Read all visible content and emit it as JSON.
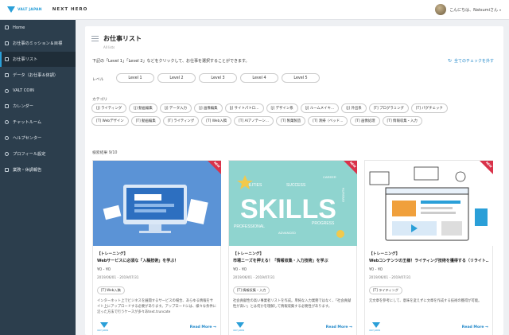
{
  "header": {
    "logo_text": "VALT JAPAN",
    "brand": "NEXT HERO",
    "greeting": "こんにちは、Natsumiさん",
    "caret": "▾"
  },
  "sidebar": {
    "items": [
      {
        "label": "Home",
        "icon": "home-icon"
      },
      {
        "label": "お仕事のミッション＆目標",
        "icon": "flag-icon"
      },
      {
        "label": "お仕事リスト",
        "icon": "list-icon"
      },
      {
        "label": "データ（お仕事＆体調）",
        "icon": "chart-icon"
      },
      {
        "label": "VALT COIN",
        "icon": "coin-icon"
      },
      {
        "label": "カレンダー",
        "icon": "calendar-icon"
      },
      {
        "label": "チャットルーム",
        "icon": "chat-icon"
      },
      {
        "label": "ヘルプセンター",
        "icon": "help-icon"
      },
      {
        "label": "プロフィール設定",
        "icon": "profile-icon"
      },
      {
        "label": "業務・休調報告",
        "icon": "report-icon"
      }
    ],
    "active_index": 2
  },
  "page": {
    "title": "お仕事リスト",
    "subtitle": "All lists",
    "instruction": "下記の「Level 1」「Level 2」などをクリックして、お仕事を選択することができます。",
    "clear_link": "全てのチェックを外す",
    "clear_icon": "↻",
    "level_label": "レベル",
    "levels": [
      "Level 1",
      "Level 2",
      "Level 3",
      "Level 4",
      "Level 5"
    ],
    "category_label": "カテゴリ",
    "categories": [
      "[J] ライティング",
      "[J] 動画編集",
      "[J] データ入力",
      "[J] 画像編集",
      "[J] サイトパトロ…",
      "[J] デザイン系",
      "[J] ルームメイキ…",
      "[J] 外出系",
      "[T] プログラミング",
      "[T] パグチェック",
      "[T] Webデザイン",
      "[T] 動画編集",
      "[T] ライティング",
      "[T] Web入稿",
      "[T] AIアノテーシ…",
      "[T] 製菓製造",
      "[T] 清掃（ベッド…",
      "[T] 画像処理",
      "[T] 情報収集・入力"
    ],
    "result_count": "検索結果 9/10"
  },
  "cards": [
    {
      "ribbon": "NEW",
      "tag": "【トレーニング】",
      "title": "Webサービスに必須な「入稿技術」を学ぶ！",
      "price": "¥0 - ¥0",
      "date": "2019/06/01 - 2019/07/31",
      "chip": "[T] Web入稿",
      "desc": "インターネット上でビジネスを展開するサービスの場合、あらゆる情報をサイト上にアップロードする必要があります。アップロードには、様々な条件に沿った方法で行うケースが多々あtext.truncate",
      "more": "Read More →",
      "thumb_color": "#5b93d6",
      "mini_logo": "VALT JAPAN"
    },
    {
      "ribbon": "NEW",
      "tag": "【トレーニング】",
      "title": "市場ニーズを押える！「情報収集・入力技術」を学ぶ",
      "price": "¥0 - ¥0",
      "date": "2019/06/01 - 2019/07/31",
      "chip": "[T] 情報収集・入力",
      "desc": "社会貢献性の高い事業者リストを作成。単純な入力業務ではなく、「社会貢献性が高い」とは何かを理解して情報収集する必要性があります。",
      "more": "Read More →",
      "thumb_color": "#8fd4cf",
      "thumb_word": "SKILLS",
      "thumb_words": [
        "ABILITIES",
        "SUCCESS",
        "CAREER",
        "PROFESSIONAL",
        "PROGRESS",
        "ADVANCED",
        "GROWTH"
      ],
      "mini_logo": "VALT JAPAN"
    },
    {
      "ribbon": "NEW",
      "tag": "【トレーニング】",
      "title": "Webコンテンツの王様！ライティング技術を獲得する（リライト…",
      "price": "¥0 - ¥0",
      "date": "2019/06/01 - 2019/07/31",
      "chip": "[T] ライティング",
      "desc": "元文章を参考にして、意味を変えずに文章を作成する技術の獲得が可能。",
      "more": "Read More →",
      "thumb_color": "#ffffff",
      "mini_logo": "VALT JAPAN"
    }
  ]
}
